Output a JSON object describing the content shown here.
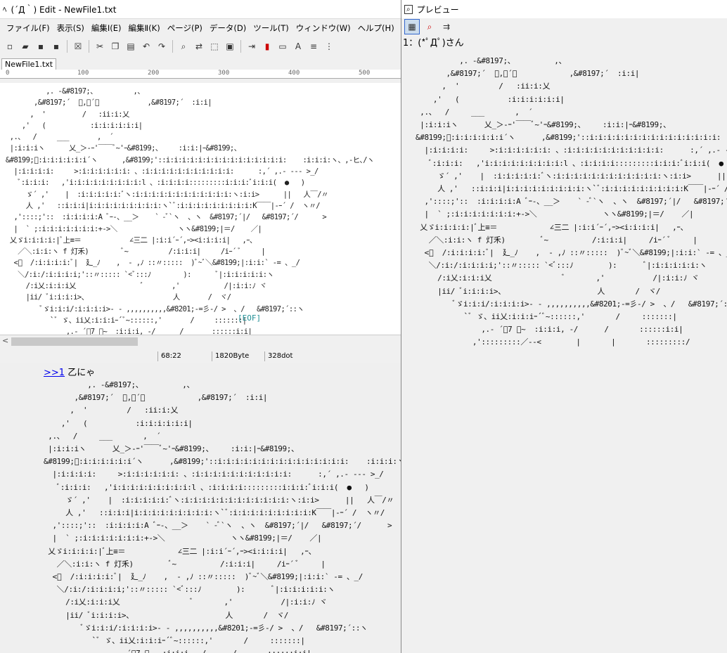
{
  "editor": {
    "title": "(´Д｀) Edit - NewFile1.txt",
    "menu": [
      "ファイル(F)",
      "表示(S)",
      "編集Ⅰ(E)",
      "編集Ⅱ(K)",
      "ページ(P)",
      "データ(D)",
      "ツール(T)",
      "ウィンドウ(W)",
      "ヘルプ(H)"
    ],
    "toolbar_icons": [
      "new-file-icon",
      "open-folder-icon",
      "save-icon",
      "save-as-icon",
      "close-doc-icon",
      "cut-icon",
      "copy-icon",
      "paste-icon",
      "undo-icon",
      "redo-icon",
      "search-icon",
      "replace-icon",
      "select-icon",
      "clip-icon",
      "insert-icon",
      "color-icon",
      "window-icon",
      "text-icon",
      "align-icon",
      "grid-icon"
    ],
    "tab": "NewFile1.txt",
    "ruler_ticks": [
      "0",
      "100",
      "200",
      "300",
      "400",
      "500"
    ],
    "eof": "[EOF]",
    "status": {
      "pos": "68:22",
      "size": "1820Byte",
      "width": "328dot"
    }
  },
  "preview": {
    "title": "プレビュー",
    "header": "1：(*ﾟДﾟ)さん"
  },
  "thread": {
    "anchor": ">>1",
    "text": "乙にゃ"
  },
  "ascii_art": "          ,. -&#8197;、         ,、\n       ,&#8197;´  ﾞ,ｰ´ﾞ            ,&#8197;´  :i:i|\n      ,  '         /   :ii:i:乂\n    ,'   (           :i:i:i:i:i:i|\n ,.、  /     ___       ,  ´\n |:i:i:iヽ      乂_＞-ｰ'￣￣ﾞ~'ｰ&#8199;、    :i:i:|ｰ&#8199;、\n&#8199;ﾞ:i:i:i:i:i:i´ヽ      ,&#8199;'::i:i:i:i:i:i:i:i:i:i:i:i:i:i:i:    :i:i:i:ヽ、,-ヒ､/ヽ\n  |:i:i:i:i:     >:i:i:i:i:i:i: 、:i:i:i:i:i:i:i:i:i:i:i:      :,´ ,.- --- >_/\n   ﾞ:i:i:i:   ,'i:i:i:i:i:i:i:i:i:l 、:i:i:i:i:::::::::i:i:i:ﾞi:i:i(  ●   )\n     ゞ´ ,'    |  :i:i:i:i:i:ﾞヽ:i:i:i:i:i:i:i:i:i:i:i:i:ヽ:i:i>      ||   人￣/〃\n     人 ,'   ::i:i:i|i:i:i:i:i:i:i:i:i:ヽ`ﾞ:i:i:i:i:i:i:i:i:i:K￣￣|-ｰ´ /  ヽ〃/\n  ,'::::;'::  :i:i:i:i:A ﾞｰ-、__＞    ` -ﾞ`ヽ  、ヽ  &#8197;´|/   &#8197;´/      >\n  |  ` ;:i:i:i:i:i:i:i:+->＼               ヽヽ&#8199;|＝/    ／|\n 乂ゞi:i:i:i:|ﾞ上≡＝            ∠三二 |:i:i´ｰ´,ｰ><i:i:i:i|   ,ｰ、\n   ／＼:i:i:ヽ f 灯禾)        ﾞ~          /:i:i:i|     /iｰ´ ﾞ     |\n  <ﾞ  /:i:i:i:i:ﾞ|  廴_ﾉ    ,  - ,ﾉ ::〃:::::  )ﾞ~ﾞ＼&#8199;|:i:i:` -= 、_/\n   ＼/:i:/:i:i:i:i;'::〃::::: `<ﾞ:::ﾉ        ):      ﾞ|:i:i:i:i:i:ヽ\n     /:i乂:i:i:i乂                ﾞ       ,'           /|:i:i:ﾉ ヾ\n     |ii/ ﾞi:i:i:i>、                     人       /  ヾ/\n         ﾞゞi:i:i/:i:i:i:i>- - ,,,,,,,,,,&#8201;-=彡-/ >  、/   &#8197;´::ヽ\n           `ﾞ ゞ、ii乂:i:i:iｰ´ﾞ~::::::,'       /     :::::::|\n               ,.- ´ﾞ7 ﾞ~  :i:i:i, -/      /       ::::::i:i|\n             ,':::::::::／--<        |       |       :::::::::/"
}
